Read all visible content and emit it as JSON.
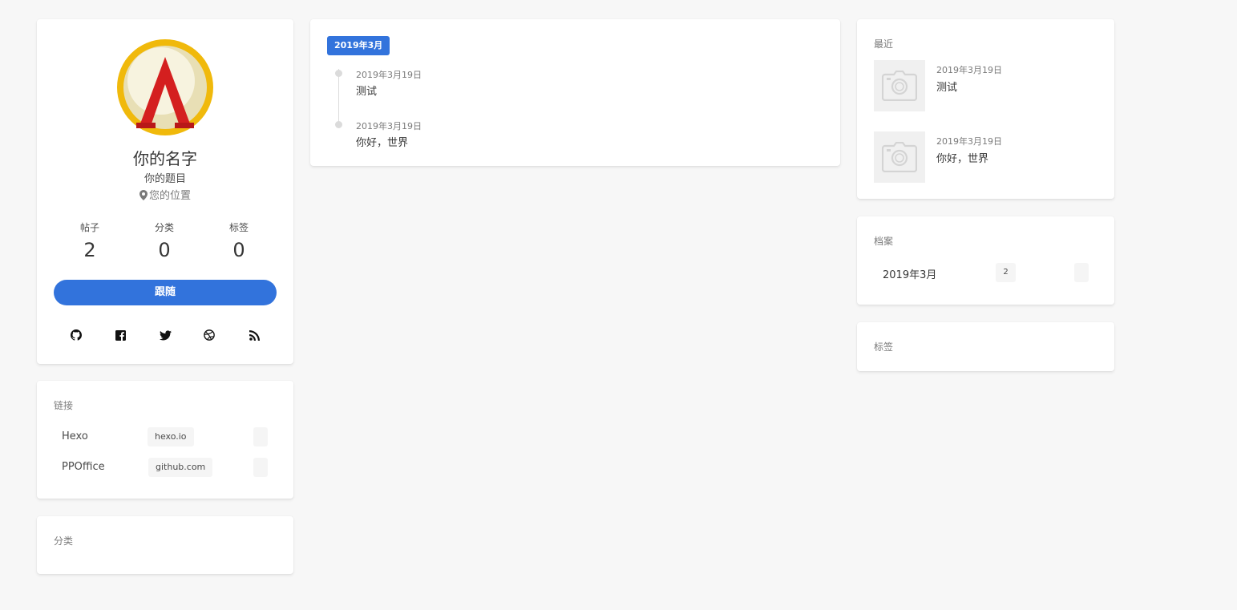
{
  "profile": {
    "name": "你的名字",
    "title": "你的题目",
    "location": "您的位置",
    "stats": [
      {
        "label": "帖子",
        "value": "2"
      },
      {
        "label": "分类",
        "value": "0"
      },
      {
        "label": "标签",
        "value": "0"
      }
    ],
    "follow_label": "跟随",
    "social_icons": [
      "github-icon",
      "facebook-icon",
      "twitter-icon",
      "dribbble-icon",
      "rss-icon"
    ],
    "colors": {
      "accent": "#3273dc",
      "avatar_ring": "#f0b90b",
      "avatar_logo": "#d41f1f"
    }
  },
  "links": {
    "title": "链接",
    "items": [
      {
        "name": "Hexo",
        "host": "hexo.io"
      },
      {
        "name": "PPOffice",
        "host": "github.com"
      }
    ]
  },
  "categories_widget": {
    "title": "分类"
  },
  "timeline": {
    "month": "2019年3月",
    "posts": [
      {
        "date": "2019年3月19日",
        "title": "测试"
      },
      {
        "date": "2019年3月19日",
        "title": "你好，世界"
      }
    ]
  },
  "recent": {
    "title": "最近",
    "posts": [
      {
        "date": "2019年3月19日",
        "title": "测试",
        "thumb_icon": "camera-icon"
      },
      {
        "date": "2019年3月19日",
        "title": "你好，世界",
        "thumb_icon": "camera-icon"
      }
    ]
  },
  "archives": {
    "title": "档案",
    "items": [
      {
        "month": "2019年3月",
        "count": "2"
      }
    ]
  },
  "tags_widget": {
    "title": "标签"
  }
}
